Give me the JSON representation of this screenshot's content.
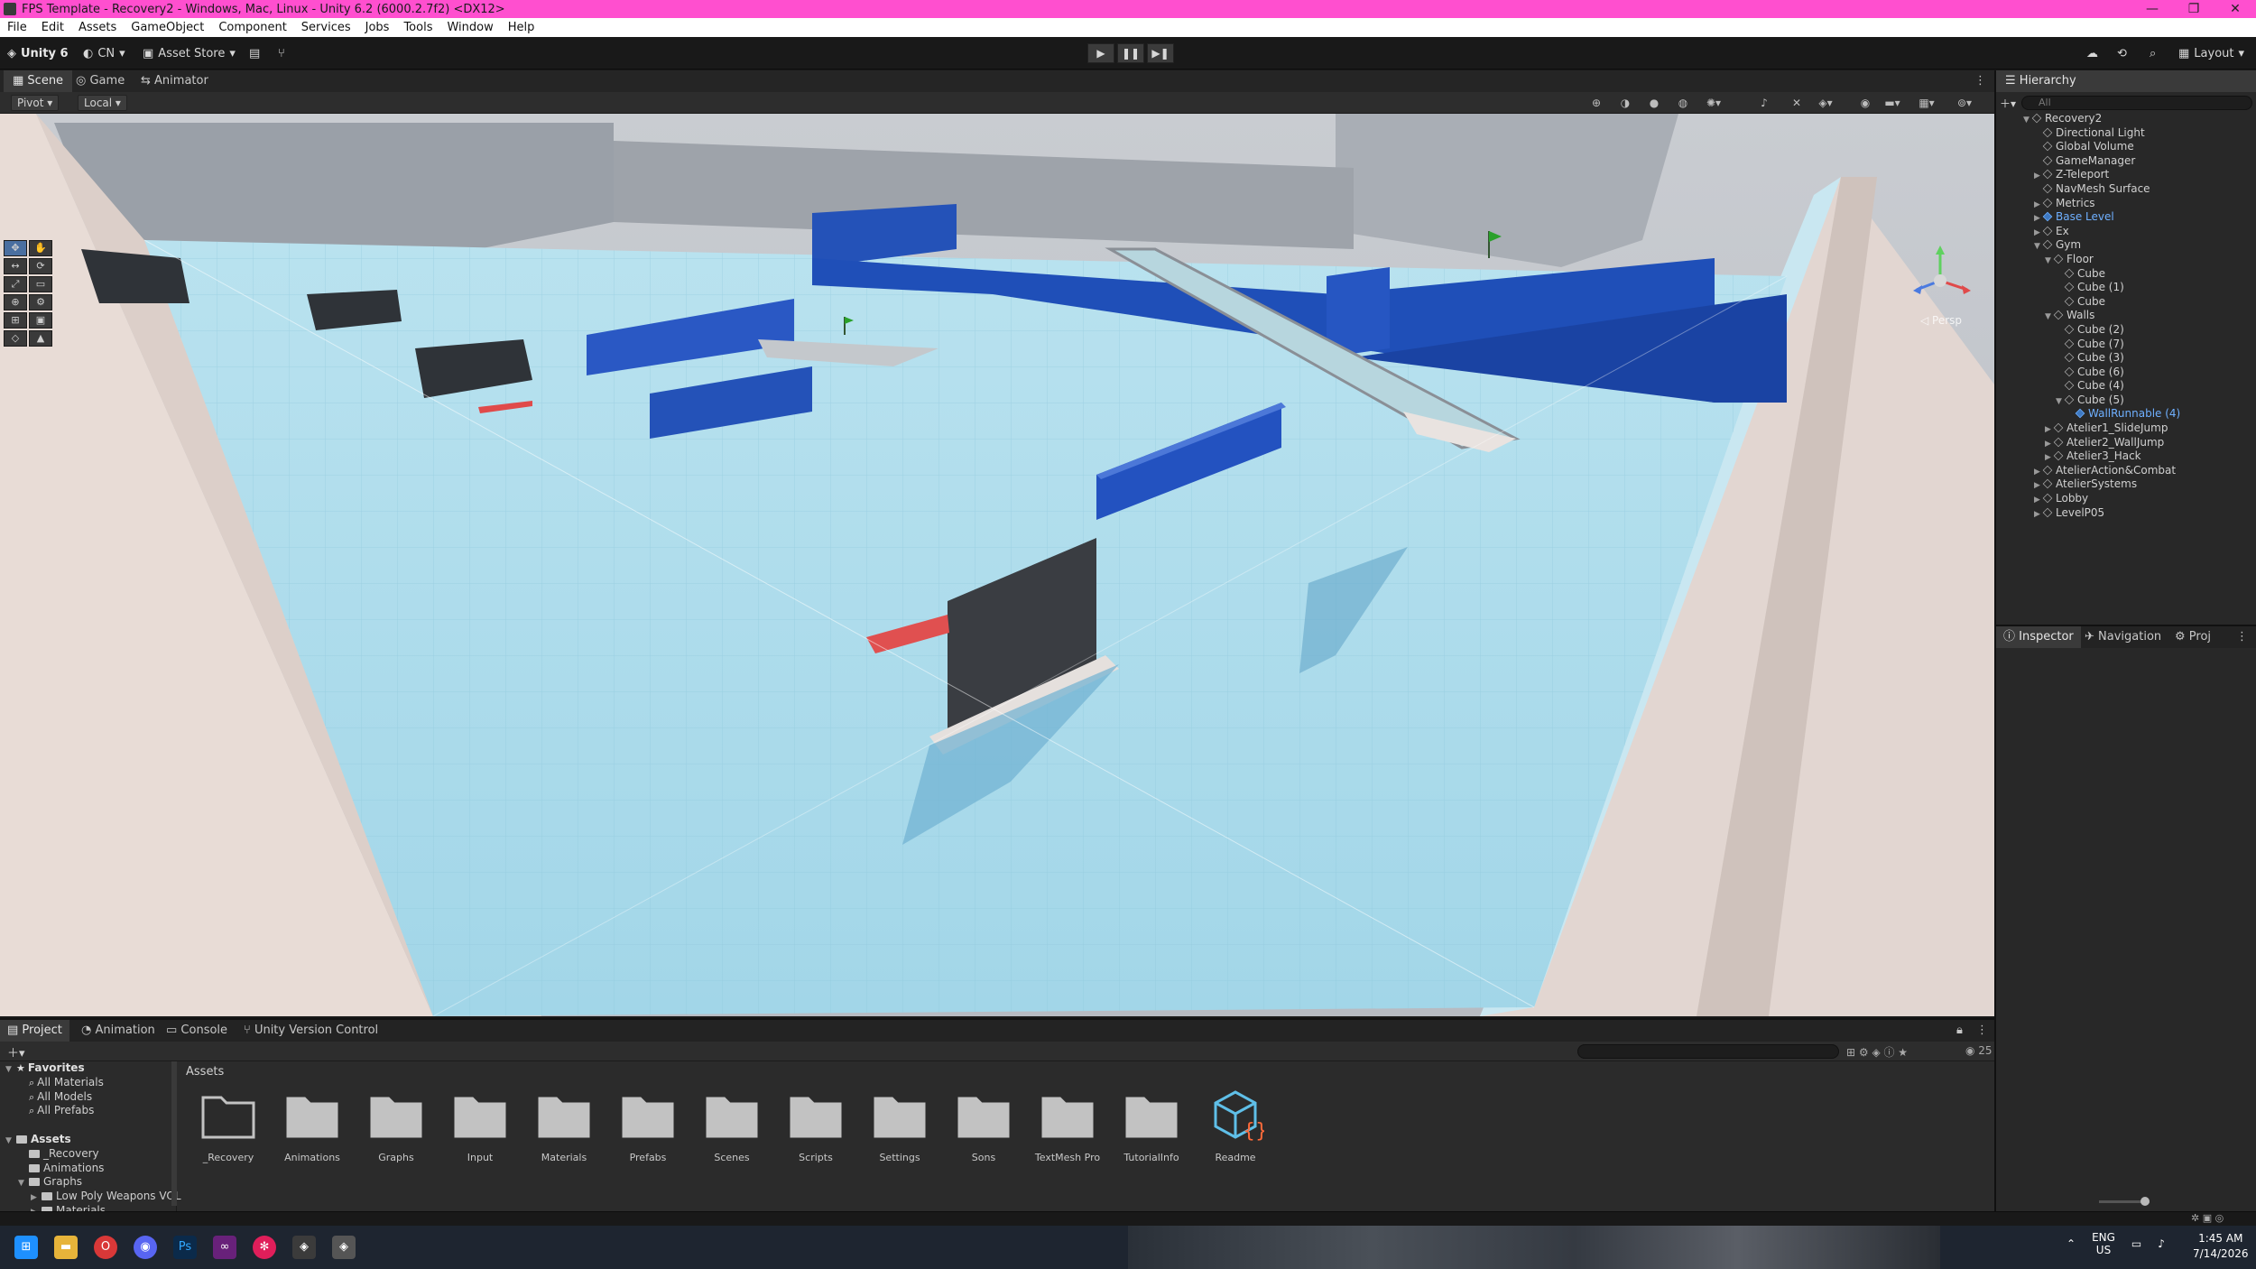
{
  "window": {
    "title": "FPS Template - Recovery2 - Windows, Mac, Linux - Unity 6.2 (6000.2.7f2) <DX12>",
    "controls": [
      "—",
      "❐",
      "✕"
    ]
  },
  "menu": [
    "File",
    "Edit",
    "Assets",
    "GameObject",
    "Component",
    "Services",
    "Jobs",
    "Tools",
    "Window",
    "Help"
  ],
  "toolbar": {
    "unity_label": "Unity 6",
    "account_label": "CN",
    "asset_store_label": "Asset Store",
    "layout_label": "Layout",
    "play_icon": "play-icon",
    "pause_icon": "pause-icon",
    "step_icon": "step-icon"
  },
  "scene": {
    "tabs": [
      "Scene",
      "Game",
      "Animator"
    ],
    "pivot_label": "Pivot",
    "local_label": "Local",
    "persp_label": "◁ Persp"
  },
  "hierarchy": {
    "tab": "Hierarchy",
    "search_placeholder": "All",
    "items": [
      {
        "label": "Recovery2",
        "depth": 0,
        "arrow": "▼",
        "blue": false
      },
      {
        "label": "Directional Light",
        "depth": 1,
        "arrow": "",
        "blue": false
      },
      {
        "label": "Global Volume",
        "depth": 1,
        "arrow": "",
        "blue": false
      },
      {
        "label": "GameManager",
        "depth": 1,
        "arrow": "",
        "blue": false
      },
      {
        "label": "Z-Teleport",
        "depth": 1,
        "arrow": "▶",
        "blue": false
      },
      {
        "label": "NavMesh Surface",
        "depth": 1,
        "arrow": "",
        "blue": false
      },
      {
        "label": "Metrics",
        "depth": 1,
        "arrow": "▶",
        "blue": false
      },
      {
        "label": "Base Level",
        "depth": 1,
        "arrow": "▶",
        "blue": true,
        "chev": true
      },
      {
        "label": "Ex",
        "depth": 1,
        "arrow": "▶",
        "blue": false
      },
      {
        "label": "Gym",
        "depth": 1,
        "arrow": "▼",
        "blue": false
      },
      {
        "label": "Floor",
        "depth": 2,
        "arrow": "▼",
        "blue": false
      },
      {
        "label": "Cube",
        "depth": 3,
        "arrow": "",
        "blue": false
      },
      {
        "label": "Cube (1)",
        "depth": 3,
        "arrow": "",
        "blue": false
      },
      {
        "label": "Cube",
        "depth": 3,
        "arrow": "",
        "blue": false
      },
      {
        "label": "Walls",
        "depth": 2,
        "arrow": "▼",
        "blue": false
      },
      {
        "label": "Cube (2)",
        "depth": 3,
        "arrow": "",
        "blue": false
      },
      {
        "label": "Cube (7)",
        "depth": 3,
        "arrow": "",
        "blue": false
      },
      {
        "label": "Cube (3)",
        "depth": 3,
        "arrow": "",
        "blue": false
      },
      {
        "label": "Cube (6)",
        "depth": 3,
        "arrow": "",
        "blue": false
      },
      {
        "label": "Cube (4)",
        "depth": 3,
        "arrow": "",
        "blue": false
      },
      {
        "label": "Cube (5)",
        "depth": 3,
        "arrow": "▼",
        "blue": false
      },
      {
        "label": "WallRunnable (4)",
        "depth": 4,
        "arrow": "",
        "blue": true,
        "chev": true
      },
      {
        "label": "Atelier1_SlideJump",
        "depth": 2,
        "arrow": "▶",
        "blue": false
      },
      {
        "label": "Atelier2_WallJump",
        "depth": 2,
        "arrow": "▶",
        "blue": false
      },
      {
        "label": "Atelier3_Hack",
        "depth": 2,
        "arrow": "▶",
        "blue": false
      },
      {
        "label": "AtelierAction&Combat",
        "depth": 1,
        "arrow": "▶",
        "blue": false
      },
      {
        "label": "AtelierSystems",
        "depth": 1,
        "arrow": "▶",
        "blue": false
      },
      {
        "label": "Lobby",
        "depth": 1,
        "arrow": "▶",
        "blue": false
      },
      {
        "label": "LevelP05",
        "depth": 1,
        "arrow": "▶",
        "blue": false
      }
    ]
  },
  "inspector": {
    "tabs": [
      "Inspector",
      "Navigation",
      "Proj"
    ]
  },
  "project": {
    "tabs": [
      "Project",
      "Animation",
      "Console",
      "Unity Version Control"
    ],
    "breadcrumb": "Assets",
    "count": "25",
    "tree": [
      {
        "label": "Favorites",
        "depth": 0,
        "arrow": "▼",
        "kind": "star",
        "bold": true
      },
      {
        "label": "All Materials",
        "depth": 1,
        "arrow": "",
        "kind": "search",
        "bold": false
      },
      {
        "label": "All Models",
        "depth": 1,
        "arrow": "",
        "kind": "search",
        "bold": false
      },
      {
        "label": "All Prefabs",
        "depth": 1,
        "arrow": "",
        "kind": "search",
        "bold": false
      },
      {
        "label": "",
        "depth": 0,
        "arrow": "",
        "kind": "gap",
        "bold": false
      },
      {
        "label": "Assets",
        "depth": 0,
        "arrow": "▼",
        "kind": "folder",
        "bold": true
      },
      {
        "label": "_Recovery",
        "depth": 1,
        "arrow": "",
        "kind": "folder",
        "bold": false
      },
      {
        "label": "Animations",
        "depth": 1,
        "arrow": "",
        "kind": "folder",
        "bold": false
      },
      {
        "label": "Graphs",
        "depth": 1,
        "arrow": "▼",
        "kind": "folder",
        "bold": false
      },
      {
        "label": "Low Poly Weapons VOL",
        "depth": 2,
        "arrow": "▶",
        "kind": "folder",
        "bold": false
      },
      {
        "label": "Materials",
        "depth": 2,
        "arrow": "▶",
        "kind": "folder",
        "bold": false
      }
    ],
    "assets": [
      "_Recovery",
      "Animations",
      "Graphs",
      "Input",
      "Materials",
      "Prefabs",
      "Scenes",
      "Scripts",
      "Settings",
      "Sons",
      "TextMesh Pro",
      "TutorialInfo",
      "Readme"
    ]
  },
  "taskbar": {
    "lang": "ENG",
    "region": "US",
    "time": "1:45 AM",
    "date": "7/14/2026"
  },
  "colors": {
    "titlebar": "#ff4fcf",
    "accent_blue": "#3e79c2",
    "floor": "#a8d8e8",
    "wall_blue": "#1f4fb8"
  }
}
